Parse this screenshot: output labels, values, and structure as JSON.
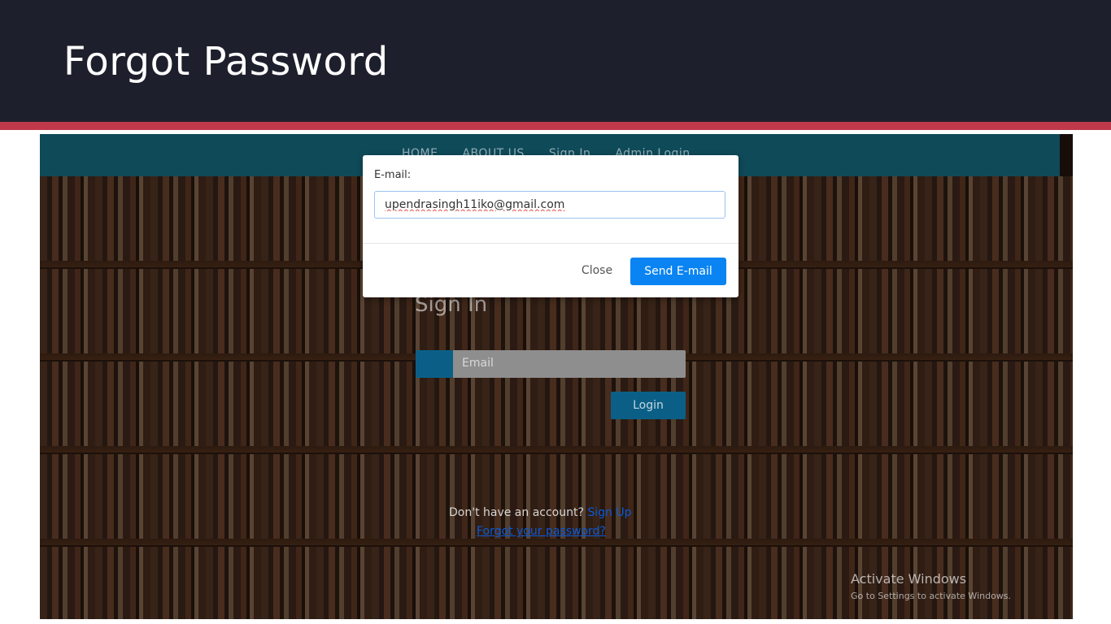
{
  "slide": {
    "title": "Forgot Password"
  },
  "site": {
    "nav": [
      "HOME",
      "ABOUT US",
      "Sign In",
      "Admin Login"
    ],
    "signin_title": "Sign In",
    "email_placeholder": "Email",
    "login_label": "Login",
    "no_account_text": "Don't have an account?",
    "signup_link": "Sign Up",
    "forgot_link": "Forgot your password?"
  },
  "modal": {
    "email_label": "E-mail:",
    "email_value": "upendrasingh11iko@gmail.com",
    "close_label": "Close",
    "send_label": "Send E-mail"
  },
  "watermark": {
    "title": "Activate Windows",
    "subtitle": "Go to Settings to activate Windows."
  },
  "colors": {
    "header_bg": "#1e1f2c",
    "accent_bar": "#c0394a",
    "nav_bg": "#0f4a59",
    "primary_button": "#0a84f2"
  }
}
